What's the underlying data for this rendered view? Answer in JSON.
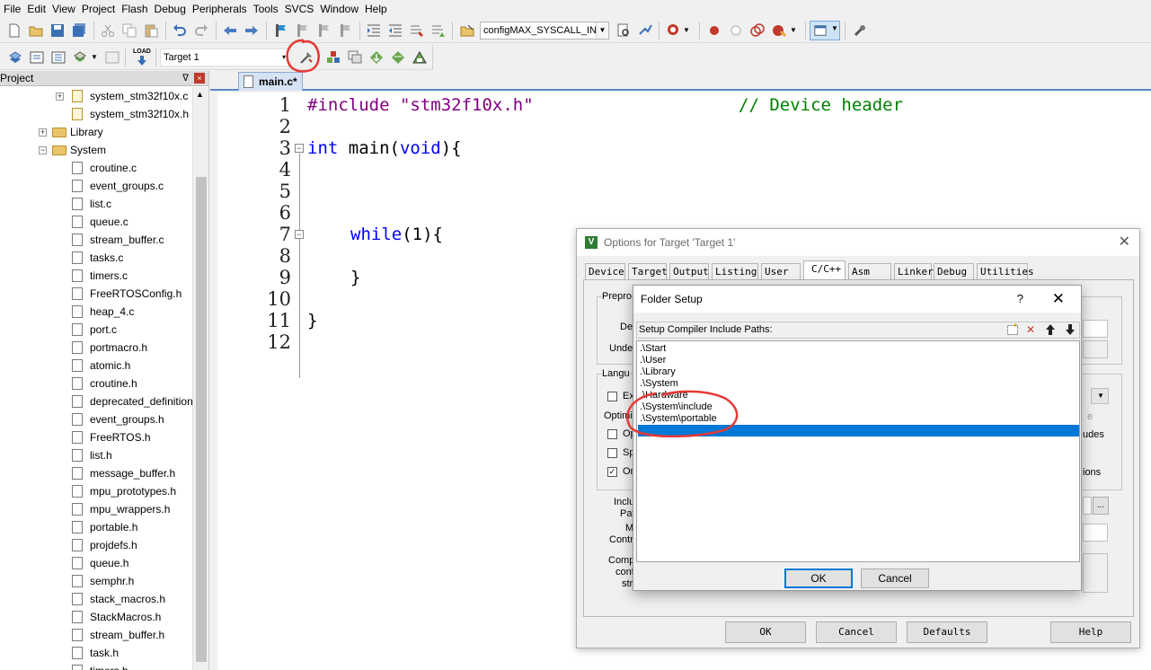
{
  "menu": [
    "File",
    "Edit",
    "View",
    "Project",
    "Flash",
    "Debug",
    "Peripherals",
    "Tools",
    "SVCS",
    "Window",
    "Help"
  ],
  "toolbar": {
    "define_combo": "configMAX_SYSCALL_INTE",
    "target_combo": "Target 1",
    "load_label": "LOAD"
  },
  "project_panel": {
    "title": "Project",
    "pin": "ᐁ",
    "close": "×",
    "items": [
      {
        "label": "system_stm32f10x.c",
        "kind": "file-key",
        "level": 3,
        "expander": "+"
      },
      {
        "label": "system_stm32f10x.h",
        "kind": "file-key",
        "level": 3,
        "expander": ""
      },
      {
        "label": "Library",
        "kind": "folder",
        "level": 2,
        "expander": "+"
      },
      {
        "label": "System",
        "kind": "folder",
        "level": 2,
        "expander": "−"
      },
      {
        "label": "croutine.c",
        "kind": "file",
        "level": 3,
        "expander": ""
      },
      {
        "label": "event_groups.c",
        "kind": "file",
        "level": 3,
        "expander": ""
      },
      {
        "label": "list.c",
        "kind": "file",
        "level": 3,
        "expander": ""
      },
      {
        "label": "queue.c",
        "kind": "file",
        "level": 3,
        "expander": ""
      },
      {
        "label": "stream_buffer.c",
        "kind": "file",
        "level": 3,
        "expander": ""
      },
      {
        "label": "tasks.c",
        "kind": "file",
        "level": 3,
        "expander": ""
      },
      {
        "label": "timers.c",
        "kind": "file",
        "level": 3,
        "expander": ""
      },
      {
        "label": "FreeRTOSConfig.h",
        "kind": "file",
        "level": 3,
        "expander": ""
      },
      {
        "label": "heap_4.c",
        "kind": "file",
        "level": 3,
        "expander": ""
      },
      {
        "label": "port.c",
        "kind": "file",
        "level": 3,
        "expander": ""
      },
      {
        "label": "portmacro.h",
        "kind": "file",
        "level": 3,
        "expander": ""
      },
      {
        "label": "atomic.h",
        "kind": "file",
        "level": 3,
        "expander": ""
      },
      {
        "label": "croutine.h",
        "kind": "file",
        "level": 3,
        "expander": ""
      },
      {
        "label": "deprecated_definition",
        "kind": "file",
        "level": 3,
        "expander": ""
      },
      {
        "label": "event_groups.h",
        "kind": "file",
        "level": 3,
        "expander": ""
      },
      {
        "label": "FreeRTOS.h",
        "kind": "file",
        "level": 3,
        "expander": ""
      },
      {
        "label": "list.h",
        "kind": "file",
        "level": 3,
        "expander": ""
      },
      {
        "label": "message_buffer.h",
        "kind": "file",
        "level": 3,
        "expander": ""
      },
      {
        "label": "mpu_prototypes.h",
        "kind": "file",
        "level": 3,
        "expander": ""
      },
      {
        "label": "mpu_wrappers.h",
        "kind": "file",
        "level": 3,
        "expander": ""
      },
      {
        "label": "portable.h",
        "kind": "file",
        "level": 3,
        "expander": ""
      },
      {
        "label": "projdefs.h",
        "kind": "file",
        "level": 3,
        "expander": ""
      },
      {
        "label": "queue.h",
        "kind": "file",
        "level": 3,
        "expander": ""
      },
      {
        "label": "semphr.h",
        "kind": "file",
        "level": 3,
        "expander": ""
      },
      {
        "label": "stack_macros.h",
        "kind": "file",
        "level": 3,
        "expander": ""
      },
      {
        "label": "StackMacros.h",
        "kind": "file",
        "level": 3,
        "expander": ""
      },
      {
        "label": "stream_buffer.h",
        "kind": "file",
        "level": 3,
        "expander": ""
      },
      {
        "label": "task.h",
        "kind": "file",
        "level": 3,
        "expander": ""
      },
      {
        "label": "timers.h",
        "kind": "file",
        "level": 3,
        "expander": ""
      }
    ]
  },
  "editor": {
    "tab": "main.c*",
    "line_numbers": [
      "1",
      "2",
      "3",
      "4",
      "5",
      "6",
      "7",
      "8",
      "9",
      "10",
      "11",
      "12"
    ],
    "line1_directive": "#include",
    "line1_string": "\"stm32f10x.h\"",
    "line1_comment": "// Device header",
    "line3_type": "int",
    "line3_rest1": " main(",
    "line3_void": "void",
    "line3_rest2": "){",
    "line7_kw": "while",
    "line7_rest": "(1){",
    "line9": "}",
    "line11": "}"
  },
  "options_dialog": {
    "title": "Options for Target 'Target 1'",
    "close": "✕",
    "tabs": [
      "Device",
      "Target",
      "Output",
      "Listing",
      "User",
      "C/C++",
      "Asm",
      "Linker",
      "Debug",
      "Utilities"
    ],
    "selected_tab": "C/C++",
    "fragments": {
      "prepro": "Prepro",
      "def": "Defi",
      "undef": "Undef",
      "langu": "Langu",
      "ex": "Ex",
      "optimiz": "Optimiz",
      "op": "Op",
      "sp": "Sp",
      "on": "On",
      "inclu": "Inclu",
      "pat": "Pat",
      "m": "M",
      "contr": "Contr",
      "comp": "Comp",
      "cont": "contr",
      "stri": "stri",
      "e": "e",
      "udes": "udes",
      "ions": "ions"
    },
    "browse": "...",
    "buttons": {
      "ok": "OK",
      "cancel": "Cancel",
      "defaults": "Defaults",
      "help": "Help"
    }
  },
  "folder_setup": {
    "title": "Folder Setup",
    "help": "?",
    "close": "✕",
    "list_title": "Setup Compiler Include Paths:",
    "paths": [
      ".\\Start",
      ".\\User",
      ".\\Library",
      ".\\System",
      ".\\Hardware",
      ".\\System\\include",
      ".\\System\\portable"
    ],
    "buttons": {
      "ok": "OK",
      "cancel": "Cancel"
    }
  }
}
